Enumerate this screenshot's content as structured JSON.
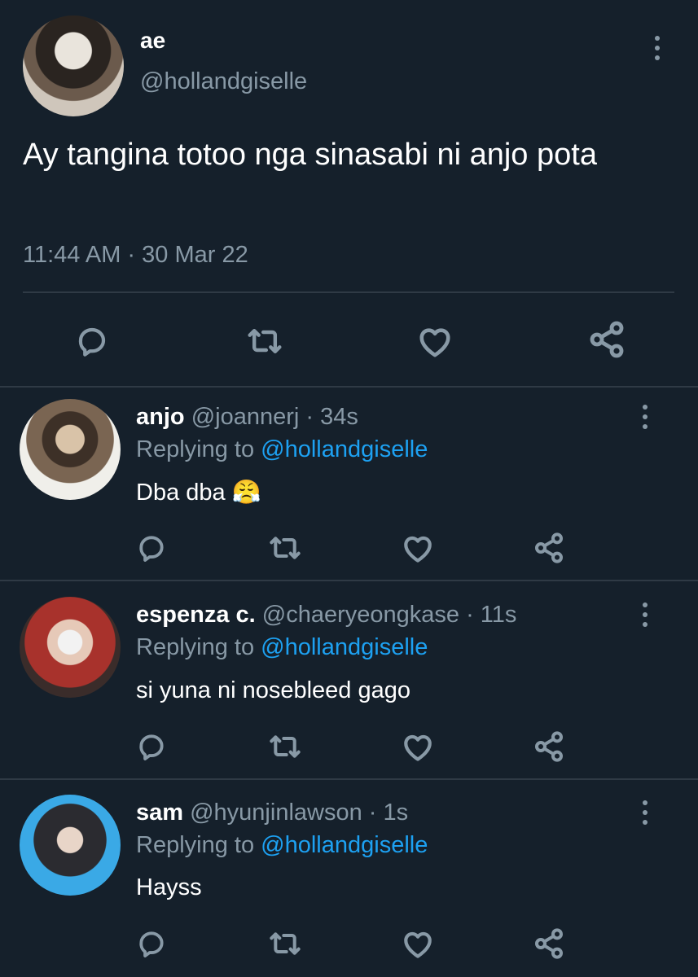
{
  "main_tweet": {
    "display_name": "ae",
    "handle": "@hollandgiselle",
    "text": "Ay tangina totoo nga sinasabi ni anjo pota",
    "timestamp": "11:44 AM · 30 Mar 22"
  },
  "replies": [
    {
      "display_name": "anjo",
      "handle": "@joannerj",
      "time": "· 34s",
      "replying_prefix": "Replying to",
      "replying_handle": "@hollandgiselle",
      "text": "Dba dba",
      "emoji": "😤"
    },
    {
      "display_name": "espenza c.",
      "handle": "@chaeryeongkase",
      "time": "· 11s",
      "replying_prefix": "Replying to",
      "replying_handle": "@hollandgiselle",
      "text": "si yuna ni nosebleed gago"
    },
    {
      "display_name": "sam",
      "handle": "@hyunjinlawson",
      "time": "· 1s",
      "replying_prefix": "Replying to",
      "replying_handle": "@hollandgiselle",
      "text": "Hayss"
    }
  ],
  "colors": {
    "background": "#15202b",
    "text": "#ffffff",
    "muted": "#8899a6",
    "accent": "#1da1f2",
    "divider": "#2f3a45"
  },
  "icons": [
    "more-vertical-icon",
    "comment-icon",
    "retweet-icon",
    "like-icon",
    "share-icon"
  ]
}
